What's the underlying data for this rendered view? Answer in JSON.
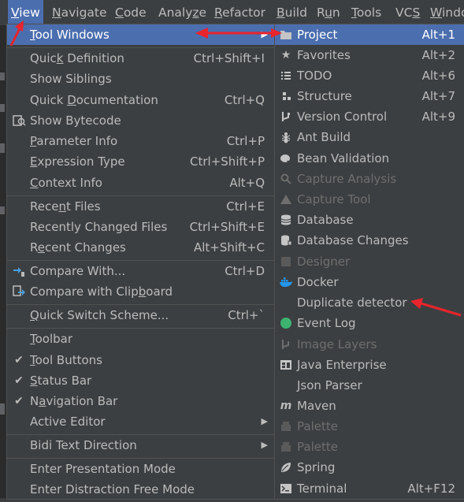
{
  "menubar": {
    "items": [
      {
        "pre": "",
        "mn": "V",
        "post": "iew"
      },
      {
        "pre": "",
        "mn": "N",
        "post": "avigate"
      },
      {
        "pre": "",
        "mn": "C",
        "post": "ode"
      },
      {
        "pre": "Analy",
        "mn": "z",
        "post": "e"
      },
      {
        "pre": "",
        "mn": "R",
        "post": "efactor"
      },
      {
        "pre": "",
        "mn": "B",
        "post": "uild"
      },
      {
        "pre": "R",
        "mn": "u",
        "post": "n"
      },
      {
        "pre": "",
        "mn": "T",
        "post": "ools"
      },
      {
        "pre": "VC",
        "mn": "S",
        "post": ""
      },
      {
        "pre": "",
        "mn": "W",
        "post": "indo"
      }
    ]
  },
  "view_menu": {
    "items": [
      {
        "pre": "",
        "mn": "T",
        "post": "ool Windows",
        "shortcut": "",
        "icon": "",
        "selected": true,
        "submenu": true
      },
      {
        "pre": "Quic",
        "mn": "k",
        "post": " Definition",
        "shortcut": "Ctrl+Shift+I",
        "icon": ""
      },
      {
        "pre": "Show Siblings",
        "mn": "",
        "post": "",
        "shortcut": "",
        "icon": ""
      },
      {
        "pre": "Quick ",
        "mn": "D",
        "post": "ocumentation",
        "shortcut": "Ctrl+Q",
        "icon": ""
      },
      {
        "pre": "Show Bytecode",
        "mn": "",
        "post": "",
        "shortcut": "",
        "icon": "bytecode-icon"
      },
      {
        "pre": "",
        "mn": "P",
        "post": "arameter Info",
        "shortcut": "Ctrl+P",
        "icon": ""
      },
      {
        "pre": "",
        "mn": "E",
        "post": "xpression Type",
        "shortcut": "Ctrl+Shift+P",
        "icon": ""
      },
      {
        "pre": "",
        "mn": "C",
        "post": "ontext Info",
        "shortcut": "Alt+Q",
        "icon": ""
      },
      {
        "pre": "Rece",
        "mn": "n",
        "post": "t Files",
        "shortcut": "Ctrl+E",
        "icon": ""
      },
      {
        "pre": "Recently Changed Files",
        "mn": "",
        "post": "",
        "shortcut": "Ctrl+Shift+E",
        "icon": ""
      },
      {
        "pre": "R",
        "mn": "e",
        "post": "cent Changes",
        "shortcut": "Alt+Shift+C",
        "icon": ""
      },
      {
        "pre": "Compare With...",
        "mn": "",
        "post": "",
        "shortcut": "Ctrl+D",
        "icon": "compare-icon"
      },
      {
        "pre": "Compare with Clip",
        "mn": "b",
        "post": "oard",
        "shortcut": "",
        "icon": "compare-clipboard-icon"
      },
      {
        "pre": "",
        "mn": "Q",
        "post": "uick Switch Scheme...",
        "shortcut": "Ctrl+`",
        "icon": ""
      },
      {
        "pre": "",
        "mn": "T",
        "post": "oolbar",
        "shortcut": "",
        "icon": ""
      },
      {
        "pre": "",
        "mn": "T",
        "post": "ool Buttons",
        "shortcut": "",
        "icon": "check-icon"
      },
      {
        "pre": "",
        "mn": "S",
        "post": "tatus Bar",
        "shortcut": "",
        "icon": "check-icon"
      },
      {
        "pre": "N",
        "mn": "a",
        "post": "vigation Bar",
        "shortcut": "",
        "icon": "check-icon"
      },
      {
        "pre": "Active Editor",
        "mn": "",
        "post": "",
        "shortcut": "",
        "icon": "",
        "submenu": true
      },
      {
        "pre": "Bidi Text Direction",
        "mn": "",
        "post": "",
        "shortcut": "",
        "icon": "",
        "submenu": true
      },
      {
        "pre": "Enter Presentation Mode",
        "mn": "",
        "post": "",
        "shortcut": "",
        "icon": ""
      },
      {
        "pre": "Enter Distraction Free Mode",
        "mn": "",
        "post": "",
        "shortcut": "",
        "icon": ""
      }
    ]
  },
  "tool_windows_menu": {
    "items": [
      {
        "label": "Project",
        "shortcut": "Alt+1",
        "icon": "folder-icon",
        "selected": true
      },
      {
        "label": "Favorites",
        "shortcut": "Alt+2",
        "icon": "star-icon"
      },
      {
        "label": "TODO",
        "shortcut": "Alt+6",
        "icon": "todo-list-icon"
      },
      {
        "label": "Structure",
        "shortcut": "Alt+7",
        "icon": "structure-icon"
      },
      {
        "label": "Version Control",
        "shortcut": "Alt+9",
        "icon": "vcs-branch-icon"
      },
      {
        "label": "Ant Build",
        "shortcut": "",
        "icon": "ant-icon"
      },
      {
        "label": "Bean Validation",
        "shortcut": "",
        "icon": "bean-icon"
      },
      {
        "label": "Capture Analysis",
        "shortcut": "",
        "icon": "capture-icon",
        "disabled": true
      },
      {
        "label": "Capture Tool",
        "shortcut": "",
        "icon": "triangle-icon",
        "disabled": true
      },
      {
        "label": "Database",
        "shortcut": "",
        "icon": "database-icon"
      },
      {
        "label": "Database Changes",
        "shortcut": "",
        "icon": "database-changes-icon"
      },
      {
        "label": "Designer",
        "shortcut": "",
        "icon": "designer-icon",
        "disabled": true
      },
      {
        "label": "Docker",
        "shortcut": "",
        "icon": "docker-icon"
      },
      {
        "label": "Duplicate detector",
        "shortcut": "",
        "icon": ""
      },
      {
        "label": "Event Log",
        "shortcut": "",
        "icon": "event-log-icon"
      },
      {
        "label": "Image Layers",
        "shortcut": "",
        "icon": "image-layers-icon",
        "disabled": true
      },
      {
        "label": "Java Enterprise",
        "shortcut": "",
        "icon": "java-enterprise-icon"
      },
      {
        "label": "Json Parser",
        "shortcut": "",
        "icon": ""
      },
      {
        "label": "Maven",
        "shortcut": "",
        "icon": "maven-icon"
      },
      {
        "label": "Palette",
        "shortcut": "",
        "icon": "palette-icon",
        "disabled": true
      },
      {
        "label": "Palette",
        "shortcut": "",
        "icon": "palette-icon",
        "disabled": true
      },
      {
        "label": "Spring",
        "shortcut": "",
        "icon": "spring-leaf-icon"
      },
      {
        "label": "Terminal",
        "shortcut": "Alt+F12",
        "icon": "terminal-icon"
      }
    ]
  },
  "colors": {
    "background": "#3c3f41",
    "selection": "#4b6eaf",
    "text": "#bbbbbb",
    "disabled_text": "#6e6e6e",
    "annotation_arrow": "#e8242c",
    "event_log_green": "#3cb371",
    "docker_blue": "#2496ed"
  }
}
